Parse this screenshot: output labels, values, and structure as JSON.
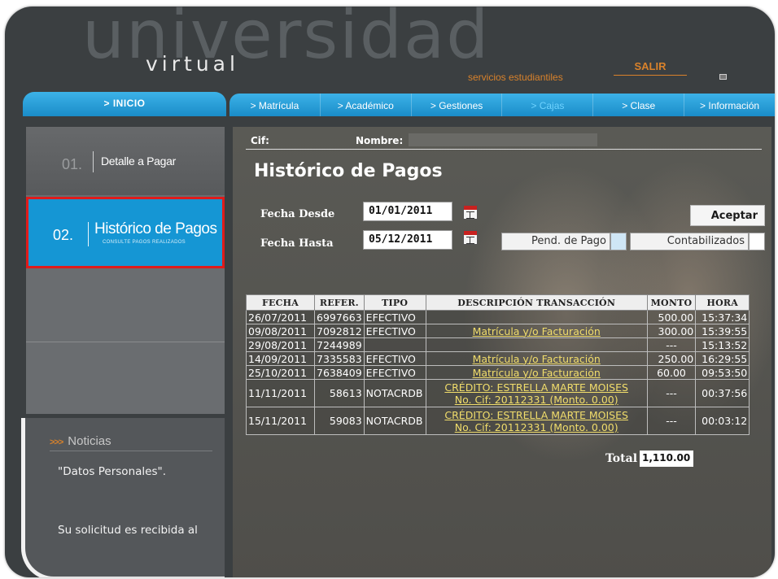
{
  "header": {
    "logo_big": "universidad",
    "logo_small": "virtual",
    "services": "servicios estudiantiles",
    "salir": "SALIR"
  },
  "nav": {
    "inicio": "> INICIO",
    "items": [
      {
        "label": "> Matrícula"
      },
      {
        "label": "> Académico"
      },
      {
        "label": "> Gestiones"
      },
      {
        "label": "> Cajas"
      },
      {
        "label": "> Clase"
      },
      {
        "label": "> Información"
      }
    ],
    "active": "> Cajas"
  },
  "sidebar": {
    "steps": [
      {
        "num": "01.",
        "title": "Detalle a Pagar",
        "subtitle": ""
      },
      {
        "num": "02.",
        "title": "Histórico de Pagos",
        "subtitle": "CONSULTE PAGOS REALIZADOS"
      }
    ]
  },
  "news": {
    "title": "Noticias",
    "lines": [
      "\"Datos Personales\".",
      "Su solicitud es recibida al"
    ]
  },
  "main": {
    "cif_label": "Cif:",
    "nombre_label": "Nombre:",
    "title": "Histórico de Pagos",
    "fecha_desde_label": "Fecha Desde",
    "fecha_desde_value": "01/01/2011",
    "fecha_hasta_label": "Fecha Hasta",
    "fecha_hasta_value": "05/12/2011",
    "aceptar": "Aceptar",
    "legend_pend": "Pend. de Pago",
    "legend_cont": "Contabilizados",
    "legend_pend_color": "#cfe6f5",
    "legend_cont_color": "#ffffff"
  },
  "table": {
    "headers": [
      "Fecha",
      "Refer.",
      "Tipo",
      "Descripción Transacción",
      "Monto",
      "Hora"
    ],
    "rows": [
      {
        "fecha": "26/07/2011",
        "refer": "6997663",
        "tipo": "EFECTIVO",
        "desc1": "",
        "desc2": "",
        "monto": "500.00",
        "hora": "15:37:34"
      },
      {
        "fecha": "09/08/2011",
        "refer": "7092812",
        "tipo": "EFECTIVO",
        "desc1": "Matrícula y/o Facturación",
        "desc2": "",
        "monto": "300.00",
        "hora": "15:39:55"
      },
      {
        "fecha": "29/08/2011",
        "refer": "7244989",
        "tipo": "",
        "desc1": "",
        "desc2": "",
        "monto": "---",
        "hora": "15:13:52"
      },
      {
        "fecha": "14/09/2011",
        "refer": "7335583",
        "tipo": "EFECTIVO",
        "desc1": "Matrícula y/o Facturación",
        "desc2": "",
        "monto": "250.00",
        "hora": "16:29:55"
      },
      {
        "fecha": "25/10/2011",
        "refer": "7638409",
        "tipo": "EFECTIVO",
        "desc1": "Matrícula y/o Facturación",
        "desc2": "",
        "monto": "60.00",
        "hora": "09:53:50"
      },
      {
        "fecha": "11/11/2011",
        "refer": "58613",
        "tipo": "NOTACRDB",
        "desc1": "CRÉDITO: ESTRELLA MARTE MOISES",
        "desc2": "No. Cif: 20112331 (Monto. 0.00)",
        "monto": "---",
        "hora": "00:37:56"
      },
      {
        "fecha": "15/11/2011",
        "refer": "59083",
        "tipo": "NOTACRDB",
        "desc1": "CRÉDITO: ESTRELLA MARTE MOISES",
        "desc2": "No. Cif: 20112331 (Monto. 0.00)",
        "monto": "---",
        "hora": "00:03:12"
      }
    ],
    "total_label": "Total",
    "total_value": "1,110.00"
  }
}
